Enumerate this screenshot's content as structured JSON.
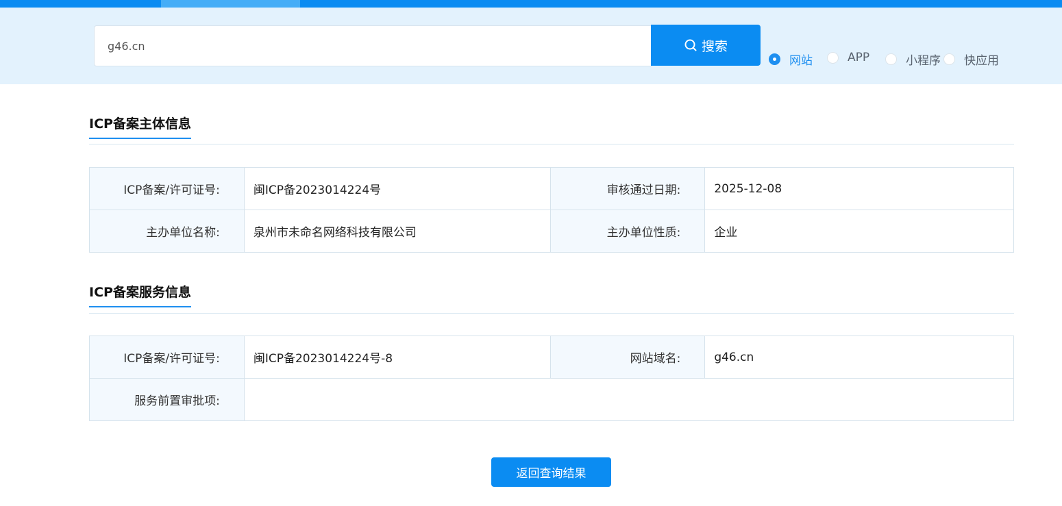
{
  "search": {
    "value": "g46.cn",
    "button_label": "搜索",
    "types": [
      {
        "label": "网站",
        "checked": true
      },
      {
        "label": "APP",
        "checked": false
      },
      {
        "label": "小程序",
        "checked": false
      },
      {
        "label": "快应用",
        "checked": false
      }
    ]
  },
  "subject": {
    "title": "ICP备案主体信息",
    "rows": [
      {
        "k1": "ICP备案/许可证号:",
        "v1": "闽ICP备2023014224号",
        "k2": "审核通过日期:",
        "v2": "2025-12-08"
      },
      {
        "k1": "主办单位名称:",
        "v1": "泉州市未命名网络科技有限公司",
        "k2": "主办单位性质:",
        "v2": "企业"
      }
    ]
  },
  "service": {
    "title": "ICP备案服务信息",
    "rows": [
      {
        "k1": "ICP备案/许可证号:",
        "v1": "闽ICP备2023014224号-8",
        "k2": "网站域名:",
        "v2": "g46.cn"
      }
    ],
    "approval_label": "服务前置审批项:",
    "approval_value": ""
  },
  "back_button": "返回查询结果",
  "colors": {
    "accent": "#0b8cf2",
    "band": "#e3f2fd",
    "key_cell": "#f3f9fe"
  }
}
